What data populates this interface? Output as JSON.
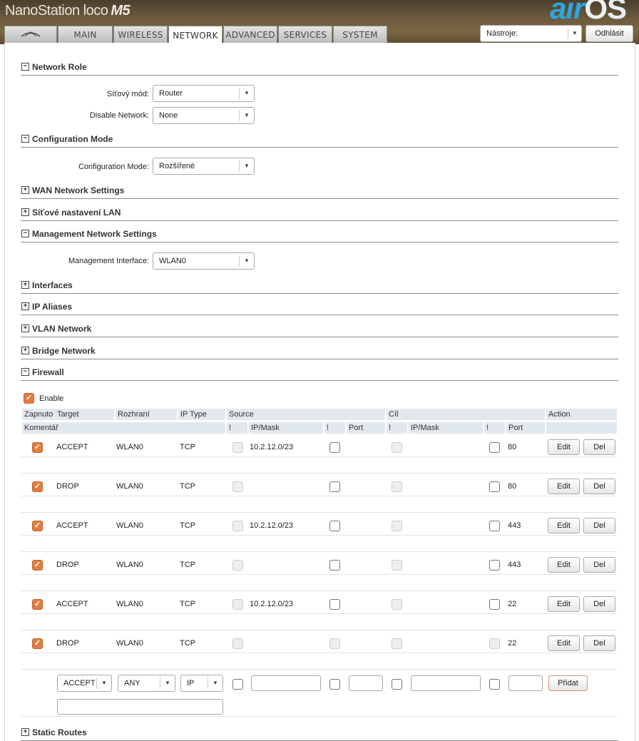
{
  "header": {
    "brand": "NanoStation loco",
    "model": "M5",
    "logo_air": "air",
    "logo_os": "OS",
    "tools_select": "Nástroje:",
    "logout_label": "Odhlásit"
  },
  "tabs": [
    {
      "label": "",
      "icon": "ubiquiti-logo-icon"
    },
    {
      "label": "MAIN"
    },
    {
      "label": "WIRELESS"
    },
    {
      "label": "NETWORK",
      "active": true
    },
    {
      "label": "ADVANCED"
    },
    {
      "label": "SERVICES"
    },
    {
      "label": "SYSTEM"
    }
  ],
  "sections": {
    "network_role": {
      "title": "Network Role",
      "toggle": "−"
    },
    "config_mode": {
      "title": "Configuration Mode",
      "toggle": "−"
    },
    "wan": {
      "title": "WAN Network Settings",
      "toggle": "+"
    },
    "lan": {
      "title": "Síťové nastavení LAN",
      "toggle": "+"
    },
    "mgmt": {
      "title": "Management Network Settings",
      "toggle": "−"
    },
    "interfaces": {
      "title": "Interfaces",
      "toggle": "+"
    },
    "ip_aliases": {
      "title": "IP Aliases",
      "toggle": "+"
    },
    "vlan": {
      "title": "VLAN Network",
      "toggle": "+"
    },
    "bridge": {
      "title": "Bridge Network",
      "toggle": "+"
    },
    "firewall": {
      "title": "Firewall",
      "toggle": "−"
    },
    "static_routes": {
      "title": "Static Routes",
      "toggle": "+"
    }
  },
  "fields": {
    "network_mode": {
      "label": "Síťový mód:",
      "value": "Router"
    },
    "disable_network": {
      "label": "Disable Network:",
      "value": "None"
    },
    "configuration_mode": {
      "label": "Configuration Mode:",
      "value": "Rozšířené"
    },
    "management_interface": {
      "label": "Management Interface:",
      "value": "WLAN0"
    }
  },
  "firewall": {
    "enable_label": "Enable",
    "headers": {
      "enabled": "Zapnuto",
      "target": "Target",
      "interface": "Rozhraní",
      "ip_type": "IP Type",
      "source": "Source",
      "dest": "Cíl",
      "action": "Action",
      "comment": "Komentář",
      "not1": "!",
      "ipmask1": "IP/Mask",
      "not2": "!",
      "port1": "Port",
      "not3": "!",
      "ipmask2": "IP/Mask",
      "not4": "!",
      "port2": "Port"
    },
    "rules": [
      {
        "target": "ACCEPT",
        "interface": "WLAN0",
        "ip_type": "TCP",
        "src_ip": "10.2.12.0/23",
        "dst_port": "80"
      },
      {
        "target": "DROP",
        "interface": "WLAN0",
        "ip_type": "TCP",
        "src_ip": "",
        "dst_port": "80"
      },
      {
        "target": "ACCEPT",
        "interface": "WLAN0",
        "ip_type": "TCP",
        "src_ip": "10.2.12.0/23",
        "dst_port": "443"
      },
      {
        "target": "DROP",
        "interface": "WLAN0",
        "ip_type": "TCP",
        "src_ip": "",
        "dst_port": "443"
      },
      {
        "target": "ACCEPT",
        "interface": "WLAN0",
        "ip_type": "TCP",
        "src_ip": "10.2.12.0/23",
        "dst_port": "22"
      },
      {
        "target": "DROP",
        "interface": "WLAN0",
        "ip_type": "TCP",
        "src_ip": "",
        "dst_port": "22"
      }
    ],
    "edit_label": "Edit",
    "del_label": "Del",
    "new_rule": {
      "target": "ACCEPT",
      "interface": "ANY",
      "ip_type": "IP",
      "add_label": "Přidat"
    }
  }
}
